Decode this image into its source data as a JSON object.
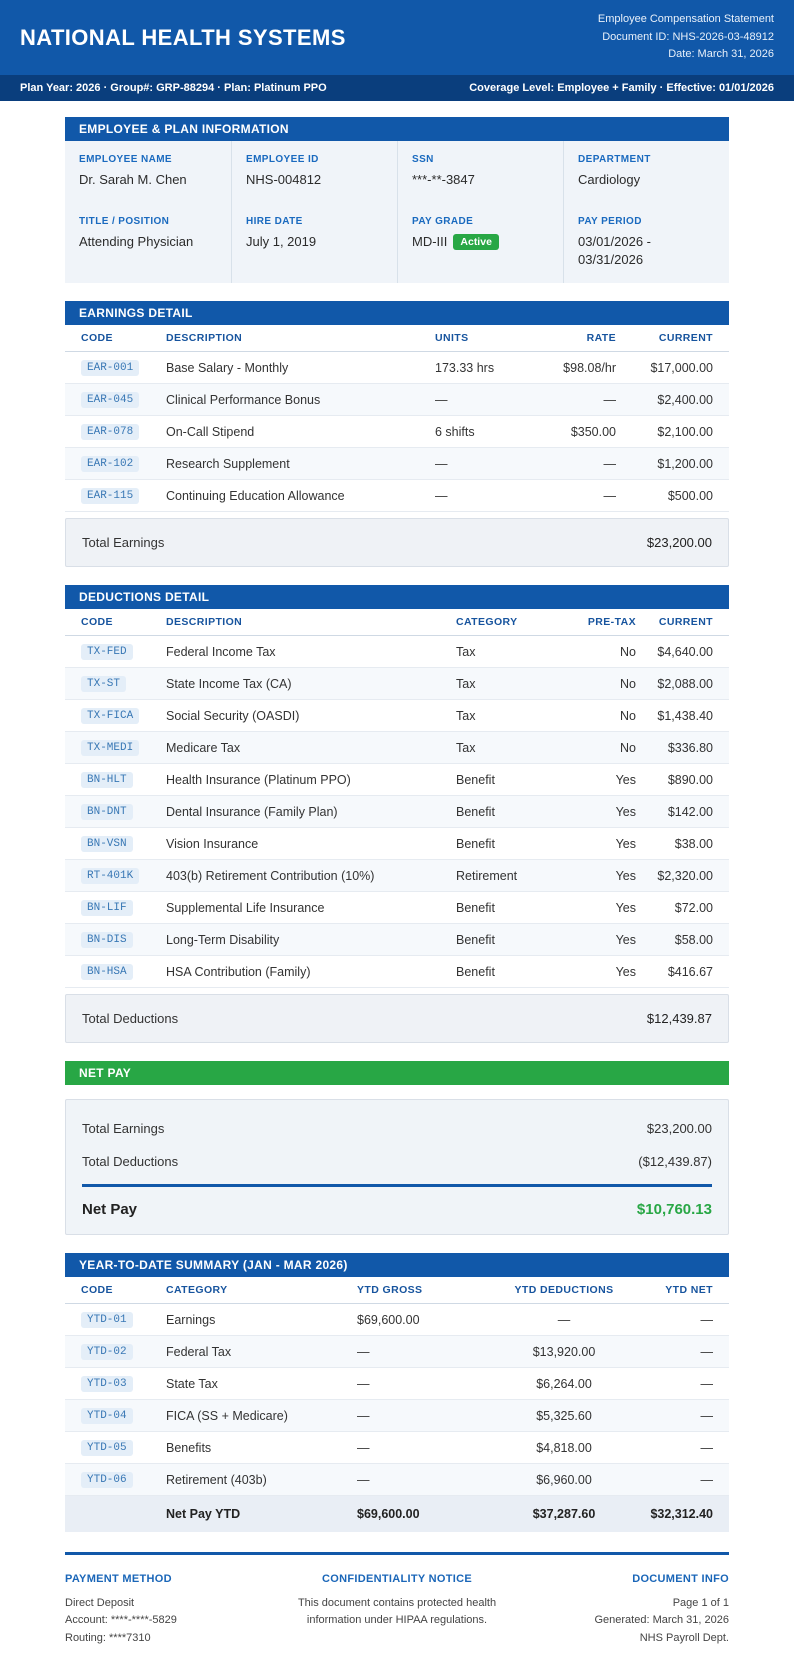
{
  "header": {
    "org_name": "NATIONAL HEALTH SYSTEMS",
    "doc_type": "Employee Compensation Statement",
    "doc_id": "Document ID: NHS-2026-03-48912",
    "date": "Date: March 31, 2026"
  },
  "plan_bar": {
    "left": "Plan Year: 2026 · Group#: GRP-88294 · Plan: Platinum PPO",
    "right": "Coverage Level: Employee + Family · Effective: 01/01/2026"
  },
  "employee_info": {
    "title": "EMPLOYEE & PLAN INFORMATION",
    "fields": [
      {
        "label": "EMPLOYEE NAME",
        "value": "Dr. Sarah M. Chen"
      },
      {
        "label": "EMPLOYEE ID",
        "value": "NHS-004812"
      },
      {
        "label": "SSN",
        "value": "***-**-3847"
      },
      {
        "label": "DEPARTMENT",
        "value": "Cardiology"
      },
      {
        "label": "TITLE / POSITION",
        "value": "Attending Physician"
      },
      {
        "label": "HIRE DATE",
        "value": "July 1, 2019"
      },
      {
        "label": "PAY GRADE",
        "value": "MD-III",
        "badge": "Active"
      },
      {
        "label": "PAY PERIOD",
        "value": "03/01/2026 - 03/31/2026"
      }
    ]
  },
  "earnings": {
    "title": "EARNINGS DETAIL",
    "columns": [
      "CODE",
      "DESCRIPTION",
      "UNITS",
      "RATE",
      "CURRENT"
    ],
    "rows": [
      {
        "code": "EAR-001",
        "description": "Base Salary - Monthly",
        "units": "173.33 hrs",
        "rate": "$98.08/hr",
        "current": "$17,000.00"
      },
      {
        "code": "EAR-045",
        "description": "Clinical Performance Bonus",
        "units": "—",
        "rate": "—",
        "current": "$2,400.00"
      },
      {
        "code": "EAR-078",
        "description": "On-Call Stipend",
        "units": "6 shifts",
        "rate": "$350.00",
        "current": "$2,100.00"
      },
      {
        "code": "EAR-102",
        "description": "Research Supplement",
        "units": "—",
        "rate": "—",
        "current": "$1,200.00"
      },
      {
        "code": "EAR-115",
        "description": "Continuing Education Allowance",
        "units": "—",
        "rate": "—",
        "current": "$500.00"
      }
    ],
    "total_label": "Total Earnings",
    "total_value": "$23,200.00"
  },
  "deductions": {
    "title": "DEDUCTIONS DETAIL",
    "columns": [
      "CODE",
      "DESCRIPTION",
      "CATEGORY",
      "PRE-TAX",
      "CURRENT"
    ],
    "rows": [
      {
        "code": "TX-FED",
        "description": "Federal Income Tax",
        "category": "Tax",
        "pretax": "No",
        "current": "$4,640.00"
      },
      {
        "code": "TX-ST",
        "description": "State Income Tax (CA)",
        "category": "Tax",
        "pretax": "No",
        "current": "$2,088.00"
      },
      {
        "code": "TX-FICA",
        "description": "Social Security (OASDI)",
        "category": "Tax",
        "pretax": "No",
        "current": "$1,438.40"
      },
      {
        "code": "TX-MEDI",
        "description": "Medicare Tax",
        "category": "Tax",
        "pretax": "No",
        "current": "$336.80"
      },
      {
        "code": "BN-HLT",
        "description": "Health Insurance (Platinum PPO)",
        "category": "Benefit",
        "pretax": "Yes",
        "current": "$890.00"
      },
      {
        "code": "BN-DNT",
        "description": "Dental Insurance (Family Plan)",
        "category": "Benefit",
        "pretax": "Yes",
        "current": "$142.00"
      },
      {
        "code": "BN-VSN",
        "description": "Vision Insurance",
        "category": "Benefit",
        "pretax": "Yes",
        "current": "$38.00"
      },
      {
        "code": "RT-401K",
        "description": "403(b) Retirement Contribution (10%)",
        "category": "Retirement",
        "pretax": "Yes",
        "current": "$2,320.00"
      },
      {
        "code": "BN-LIF",
        "description": "Supplemental Life Insurance",
        "category": "Benefit",
        "pretax": "Yes",
        "current": "$72.00"
      },
      {
        "code": "BN-DIS",
        "description": "Long-Term Disability",
        "category": "Benefit",
        "pretax": "Yes",
        "current": "$58.00"
      },
      {
        "code": "BN-HSA",
        "description": "HSA Contribution (Family)",
        "category": "Benefit",
        "pretax": "Yes",
        "current": "$416.67"
      }
    ],
    "total_label": "Total Deductions",
    "total_value": "$12,439.87"
  },
  "net_pay": {
    "title": "NET PAY",
    "rows": [
      {
        "label": "Total Earnings",
        "value": "$23,200.00"
      },
      {
        "label": "Total Deductions",
        "value": "($12,439.87)"
      }
    ],
    "net_label": "Net Pay",
    "net_value": "$10,760.13"
  },
  "ytd": {
    "title": "YEAR-TO-DATE SUMMARY (JAN - MAR 2026)",
    "columns": [
      "CODE",
      "CATEGORY",
      "YTD GROSS",
      "YTD DEDUCTIONS",
      "YTD NET"
    ],
    "rows": [
      {
        "code": "YTD-01",
        "category": "Earnings",
        "gross": "$69,600.00",
        "deductions": "—",
        "net": "—"
      },
      {
        "code": "YTD-02",
        "category": "Federal Tax",
        "gross": "—",
        "deductions": "$13,920.00",
        "net": "—"
      },
      {
        "code": "YTD-03",
        "category": "State Tax",
        "gross": "—",
        "deductions": "$6,264.00",
        "net": "—"
      },
      {
        "code": "YTD-04",
        "category": "FICA (SS + Medicare)",
        "gross": "—",
        "deductions": "$5,325.60",
        "net": "—"
      },
      {
        "code": "YTD-05",
        "category": "Benefits",
        "gross": "—",
        "deductions": "$4,818.00",
        "net": "—"
      },
      {
        "code": "YTD-06",
        "category": "Retirement (403b)",
        "gross": "—",
        "deductions": "$6,960.00",
        "net": "—"
      }
    ],
    "total": {
      "category": "Net Pay YTD",
      "gross": "$69,600.00",
      "deductions": "$37,287.60",
      "net": "$32,312.40"
    }
  },
  "footer": {
    "payment": {
      "title": "PAYMENT METHOD",
      "lines": [
        "Direct Deposit",
        "Account: ****-****-5829",
        "Routing: ****7310"
      ]
    },
    "confidentiality": {
      "title": "CONFIDENTIALITY NOTICE",
      "text": "This document contains protected health information under HIPAA regulations."
    },
    "doc_info": {
      "title": "DOCUMENT INFO",
      "lines": [
        "Page 1 of 1",
        "Generated: March 31, 2026",
        "NHS Payroll Dept."
      ]
    }
  },
  "colors": {
    "primary_blue": "#1158a9",
    "dark_navy": "#0a3e7d",
    "green": "#28a745",
    "code_blue": "#3978b5"
  }
}
